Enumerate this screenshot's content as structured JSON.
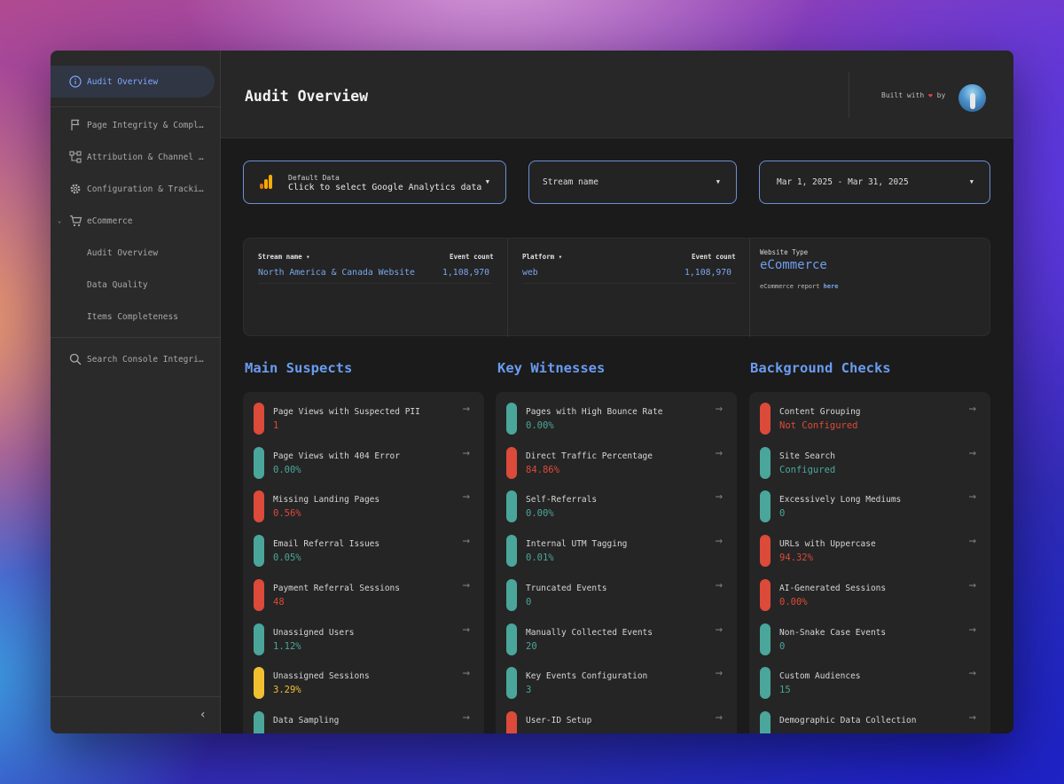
{
  "sidebar": {
    "items": [
      {
        "label": "Audit Overview",
        "icon": "info-icon",
        "active": true
      },
      {
        "label": "Page Integrity & Compl…",
        "icon": "flag-icon"
      },
      {
        "label": "Attribution & Channel …",
        "icon": "hierarchy-icon"
      },
      {
        "label": "Configuration & Tracki…",
        "icon": "gear-icon"
      },
      {
        "label": "eCommerce",
        "icon": "cart-icon",
        "expanded": true
      },
      {
        "label": "Audit Overview",
        "sub": true
      },
      {
        "label": "Data Quality",
        "sub": true
      },
      {
        "label": "Items Completeness",
        "sub": true
      },
      {
        "label": "Search Console Integri…",
        "icon": "search-icon"
      }
    ],
    "collapse_icon": "chevron-left-icon"
  },
  "header": {
    "title": "Audit Overview",
    "built_with": "Built with",
    "built_by": "by"
  },
  "selectors": {
    "ga_small": "Default Data",
    "ga_big": "Click to select Google Analytics data",
    "stream": "Stream name",
    "date": "Mar 1, 2025 - Mar 31, 2025"
  },
  "stats": {
    "table1": {
      "col1": "Stream name",
      "col2": "Event count",
      "name": "North America & Canada Website",
      "count": "1,108,970"
    },
    "table2": {
      "col1": "Platform",
      "col2": "Event count",
      "name": "web",
      "count": "1,108,970"
    },
    "website_type_label": "Website Type",
    "website_type_value": "eCommerce",
    "note_prefix": "eCommerce report",
    "note_link": "here"
  },
  "sections": [
    {
      "title": "Main Suspects",
      "items": [
        {
          "name": "Page Views with Suspected PII",
          "value": "1",
          "status": "red"
        },
        {
          "name": "Page Views with 404 Error",
          "value": "0.00%",
          "status": "green"
        },
        {
          "name": "Missing Landing Pages",
          "value": "0.56%",
          "status": "red"
        },
        {
          "name": "Email Referral Issues",
          "value": "0.05%",
          "status": "green"
        },
        {
          "name": "Payment Referral Sessions",
          "value": "48",
          "status": "red"
        },
        {
          "name": "Unassigned Users",
          "value": "1.12%",
          "status": "green"
        },
        {
          "name": "Unassigned Sessions",
          "value": "3.29%",
          "status": "yellow"
        },
        {
          "name": "Data Sampling",
          "value": "",
          "status": "green"
        }
      ]
    },
    {
      "title": "Key Witnesses",
      "items": [
        {
          "name": "Pages with High Bounce Rate",
          "value": "0.00%",
          "status": "green"
        },
        {
          "name": "Direct Traffic Percentage",
          "value": "84.86%",
          "status": "red"
        },
        {
          "name": "Self-Referrals",
          "value": "0.00%",
          "status": "green"
        },
        {
          "name": "Internal UTM Tagging",
          "value": "0.01%",
          "status": "green"
        },
        {
          "name": "Truncated Events",
          "value": "0",
          "status": "green"
        },
        {
          "name": "Manually Collected Events",
          "value": "20",
          "status": "green"
        },
        {
          "name": "Key Events Configuration",
          "value": "3",
          "status": "green"
        },
        {
          "name": "User-ID Setup",
          "value": "",
          "status": "red"
        }
      ]
    },
    {
      "title": "Background Checks",
      "items": [
        {
          "name": "Content Grouping",
          "value": "Not Configured",
          "status": "red"
        },
        {
          "name": "Site Search",
          "value": "Configured",
          "status": "green"
        },
        {
          "name": "Excessively Long Mediums",
          "value": "0",
          "status": "green"
        },
        {
          "name": "URLs with Uppercase",
          "value": "94.32%",
          "status": "red"
        },
        {
          "name": "AI-Generated Sessions",
          "value": "0.00%",
          "status": "red"
        },
        {
          "name": "Non-Snake Case Events",
          "value": "0",
          "status": "green"
        },
        {
          "name": "Custom Audiences",
          "value": "15",
          "status": "green"
        },
        {
          "name": "Demographic Data Collection",
          "value": "",
          "status": "green"
        }
      ]
    }
  ],
  "colors": {
    "accent": "#6a9bf0",
    "green": "#4aa69a",
    "red": "#dc4a3a",
    "yellow": "#f0c030"
  }
}
